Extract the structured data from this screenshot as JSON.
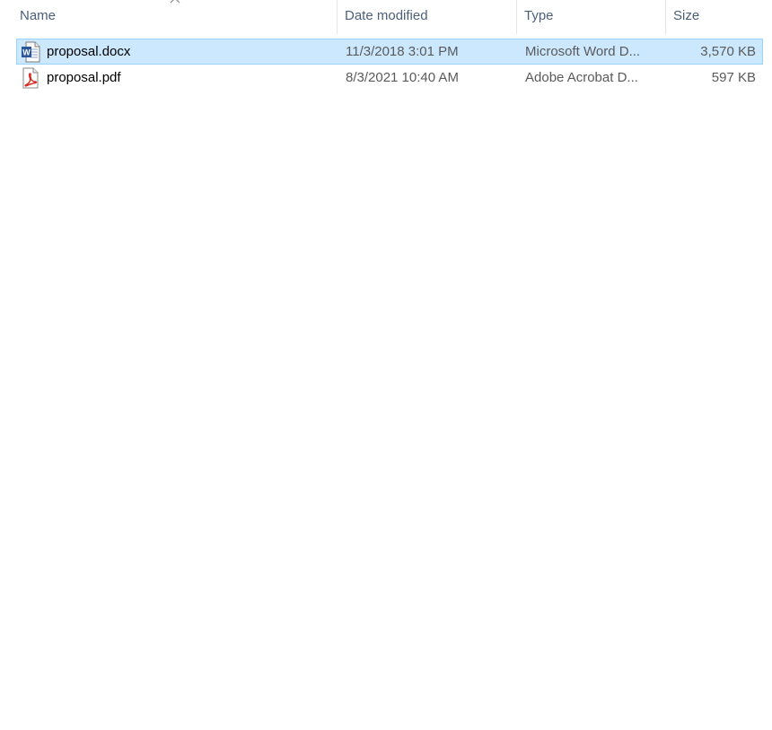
{
  "columns": {
    "name": "Name",
    "date_modified": "Date modified",
    "type": "Type",
    "size": "Size"
  },
  "sort": {
    "column": "name",
    "icon": "chevron-up-icon"
  },
  "files": [
    {
      "name": "proposal.docx",
      "date_modified": "11/3/2018 3:01 PM",
      "type": "Microsoft Word D...",
      "size": "3,570 KB",
      "icon": "word-document-icon",
      "selected": true
    },
    {
      "name": "proposal.pdf",
      "date_modified": "8/3/2021 10:40 AM",
      "type": "Adobe Acrobat D...",
      "size": "597 KB",
      "icon": "pdf-document-icon",
      "selected": false
    }
  ],
  "colors": {
    "selection_fill": "#cce8ff",
    "selection_border": "#99d1ff",
    "header_text": "#4c607a",
    "word_blue": "#2b579a",
    "pdf_red": "#d8291c"
  }
}
